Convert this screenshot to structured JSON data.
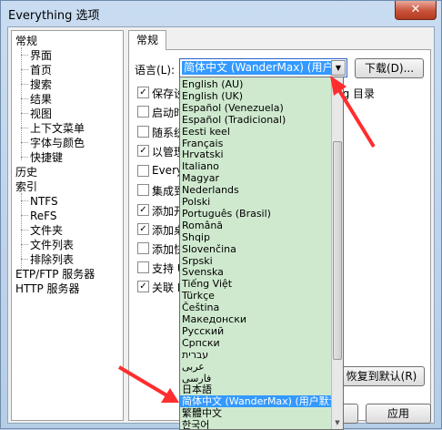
{
  "window": {
    "title": "Everything 选项",
    "close_glyph": "✕"
  },
  "tree": {
    "items": [
      "常规",
      "界面",
      "首页",
      "搜索",
      "结果",
      "视图",
      "上下文菜单",
      "字体与颜色",
      "快捷键",
      "历史",
      "索引",
      "NTFS",
      "ReFS",
      "文件夹",
      "文件列表",
      "排除列表",
      "ETP/FTP 服务器",
      "HTTP 服务器"
    ]
  },
  "tab": {
    "label": "常规"
  },
  "language": {
    "label": "语言(L):",
    "selected": "简体中文 (WanderMax) (用户默认)",
    "download_label": "下载(D)..."
  },
  "checkboxes": [
    {
      "label": "保存设",
      "checked": true
    },
    {
      "label": "启动时",
      "checked": false
    },
    {
      "label": "随系统",
      "checked": false
    },
    {
      "label": "以管理",
      "checked": true
    },
    {
      "label": "Everyt",
      "checked": false
    },
    {
      "label": "集成到",
      "checked": false
    },
    {
      "label": "添加开",
      "checked": true
    },
    {
      "label": "添加桌",
      "checked": true
    },
    {
      "label": "添加快",
      "checked": false
    },
    {
      "label": "支持 U",
      "checked": false
    },
    {
      "label": "关联 E",
      "checked": true
    }
  ],
  "right_text": "ng 目录",
  "restore_label": "恢复到默认(R)",
  "apply_label": "应用",
  "dropdown": {
    "options": [
      "English (AU)",
      "English (UK)",
      "Español (Venezuela)",
      "Español (Tradicional)",
      "Eesti keel",
      "Français",
      "Hrvatski",
      "Italiano",
      "Magyar",
      "Nederlands",
      "Polski",
      "Português (Brasil)",
      "Română",
      "Shqip",
      "Slovenčina",
      "Srpski",
      "Svenska",
      "Tiếng Việt",
      "Türkçe",
      "Čeština",
      "Македонски",
      "Русский",
      "Српски",
      "עברית",
      "عربى",
      "فارسی",
      "日本語",
      "简体中文 (WanderMax) (用户默认)",
      "繁體中文",
      "한국어"
    ],
    "selected_index": 27
  },
  "colors": {
    "highlight": "#3399ff",
    "dropdown_bg": "#cfe9cf",
    "arrow": "#ff2d2d"
  }
}
